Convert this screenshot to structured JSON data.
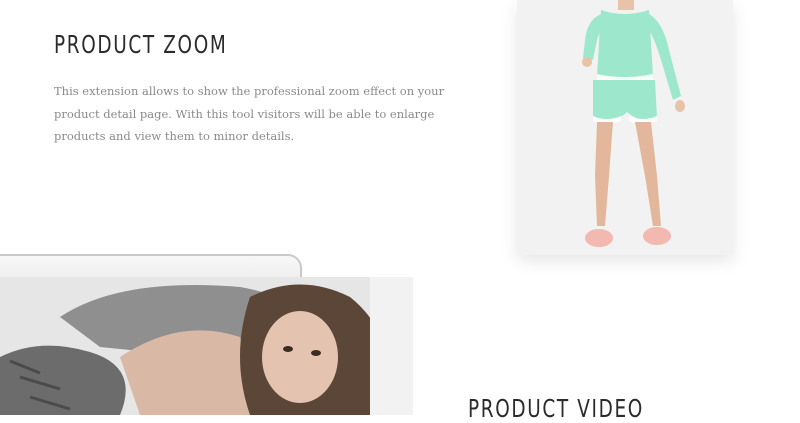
{
  "zoom_section": {
    "title": "PRODUCT ZOOM",
    "description": "This extension allows to show the professional zoom effect on your product detail page. With this tool visitors will be able to enlarge products and view them to minor details."
  },
  "video_section": {
    "title": "PRODUCT VIDEO"
  },
  "colors": {
    "heading": "#2b2b2b",
    "body_text": "#8a8a8a",
    "background": "#ffffff",
    "pajama_mint": "#9de8cc",
    "slipper_pink": "#f3b8b0"
  }
}
